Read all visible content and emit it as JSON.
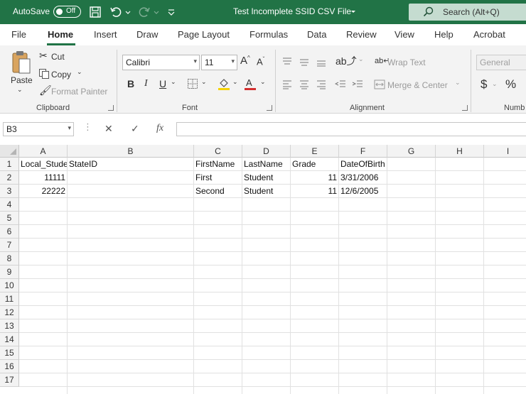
{
  "titlebar": {
    "autosave_label": "AutoSave",
    "autosave_state": "Off",
    "doc_title": "Test Incomplete SSID CSV File",
    "search_placeholder": "Search (Alt+Q)"
  },
  "menu": {
    "tabs": [
      "File",
      "Home",
      "Insert",
      "Draw",
      "Page Layout",
      "Formulas",
      "Data",
      "Review",
      "View",
      "Help",
      "Acrobat"
    ],
    "active": "Home"
  },
  "ribbon": {
    "clipboard": {
      "label": "Clipboard",
      "paste": "Paste",
      "cut": "Cut",
      "copy": "Copy",
      "format_painter": "Format Painter"
    },
    "font": {
      "label": "Font",
      "font_name": "Calibri",
      "font_size": "11",
      "bold": "B",
      "italic": "I",
      "underline": "U"
    },
    "alignment": {
      "label": "Alignment",
      "wrap_text": "Wrap Text",
      "merge_center": "Merge & Center"
    },
    "number": {
      "label": "Numb",
      "format": "General"
    }
  },
  "formula_bar": {
    "name_box": "B3",
    "fx": "fx",
    "formula": ""
  },
  "sheet": {
    "columns": [
      "A",
      "B",
      "C",
      "D",
      "E",
      "F",
      "G",
      "H",
      "I"
    ],
    "rows": [
      "1",
      "2",
      "3",
      "4",
      "5",
      "6",
      "7",
      "8",
      "9",
      "10",
      "11",
      "12",
      "13",
      "14",
      "15",
      "16",
      "17"
    ],
    "cells": {
      "A1": "Local_Stude",
      "B1": "StateID",
      "C1": "FirstName",
      "D1": "LastName",
      "E1": "Grade",
      "F1": "DateOfBirth",
      "A2": "11111",
      "C2": "First",
      "D2": "Student",
      "E2": "11",
      "F2": "3/31/2006",
      "A3": "22222",
      "C3": "Second",
      "D3": "Student",
      "E3": "11",
      "F3": "12/6/2005"
    },
    "selected_cell": "B3"
  },
  "colors": {
    "brand": "#217346",
    "font_color_bar": "#d32f2f",
    "highlight_bar": "#f5d200"
  }
}
